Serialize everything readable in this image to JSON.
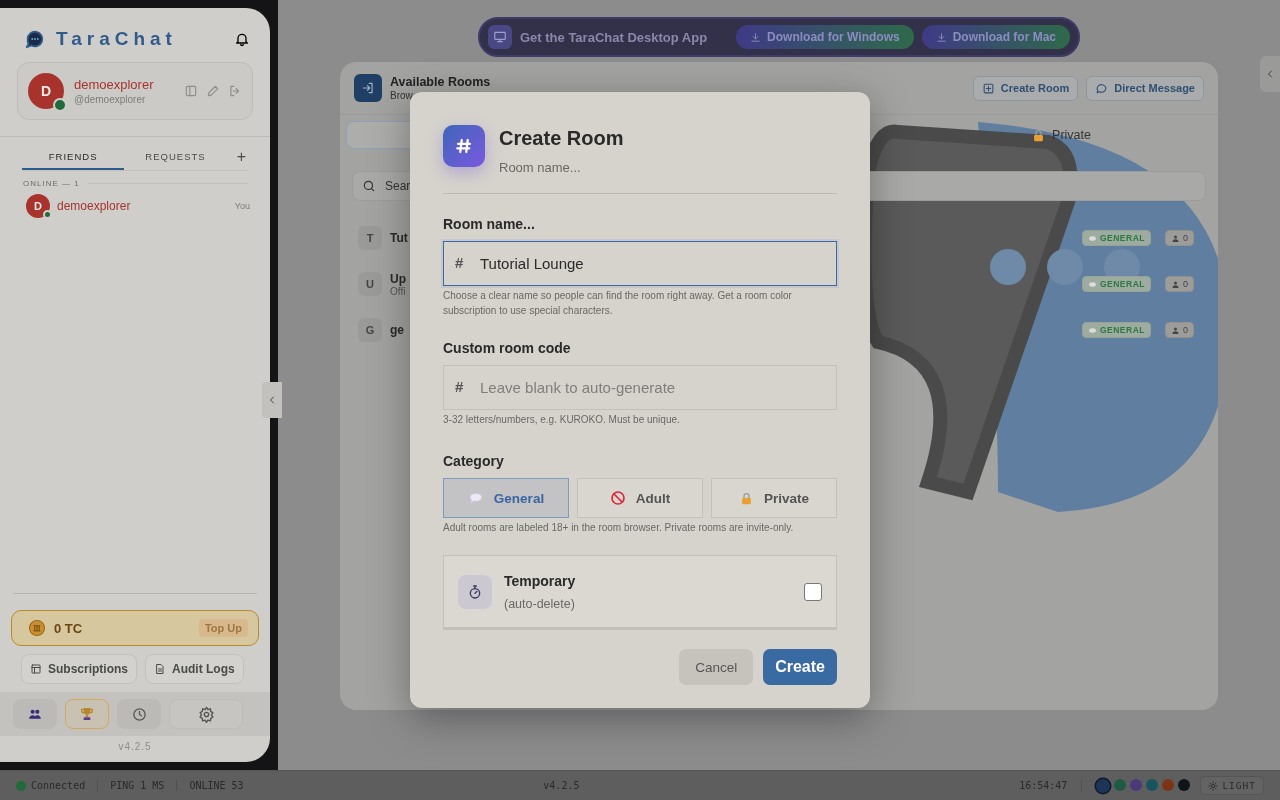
{
  "sidebar": {
    "brand": "TaraChat",
    "profile": {
      "avatar": "D",
      "name": "demoexplorer",
      "handle": "@demoexplorer",
      "online": true
    },
    "tabs": [
      {
        "label": "FRIENDS",
        "selected": true
      },
      {
        "label": "REQUESTS",
        "selected": false
      }
    ],
    "add_button": "+",
    "section_label": "ONLINE — 1",
    "friends": [
      {
        "avatar": "D",
        "name": "demoexplorer",
        "note": "You",
        "online": true
      }
    ],
    "balance": {
      "amount": "0 TC",
      "action": "Top Up"
    },
    "links": [
      {
        "label": "Subscriptions",
        "kind": "subscriptions"
      },
      {
        "label": "Audit Logs",
        "kind": "logs"
      }
    ],
    "nav": [
      {
        "kind": "friends",
        "selected": false
      },
      {
        "kind": "trophy",
        "selected": true
      },
      {
        "kind": "history",
        "selected": false
      },
      {
        "kind": "settings",
        "selected": false
      }
    ],
    "version": "v4.2.5"
  },
  "banner": {
    "text": "Get the TaraChat Desktop App",
    "buttons": [
      "Download for Windows",
      "Download for Mac"
    ]
  },
  "rooms_panel": {
    "title": "Available Rooms",
    "subtitle": "Brow",
    "actions": [
      {
        "label": "Create Room",
        "kind": "create"
      },
      {
        "label": "Direct Message",
        "kind": "message"
      }
    ],
    "tabs": [
      {
        "selected": true
      },
      {
        "label": "Private",
        "selected": false
      }
    ],
    "search": {
      "placeholder": "Sear"
    },
    "rooms": [
      {
        "initial": "T",
        "name": "Tut",
        "category": "GENERAL",
        "members": "0"
      },
      {
        "initial": "U",
        "name": "Up",
        "detail": "Offi",
        "category": "GENERAL",
        "members": "0"
      },
      {
        "initial": "G",
        "name": "ge",
        "category": "GENERAL",
        "members": "0"
      }
    ]
  },
  "dialog": {
    "title": "Create Room",
    "subtitle": "Room name...",
    "fields": [
      {
        "label": "Room name...",
        "prefix": "#",
        "value": "Tutorial Lounge",
        "focused": true,
        "hint": "Choose a clear name so people can find the room right away. Get a room color subscription to use special characters."
      },
      {
        "label": "Custom room code",
        "prefix": "#",
        "placeholder": "Leave blank to auto-generate",
        "focused": false,
        "hint": "3-32 letters/numbers, e.g. KUROKO. Must be unique."
      }
    ],
    "category": {
      "label": "Category",
      "options": [
        {
          "label": "General",
          "kind": "general",
          "selected": true
        },
        {
          "label": "Adult",
          "kind": "adult",
          "selected": false
        },
        {
          "label": "Private",
          "kind": "private",
          "selected": false
        }
      ],
      "hint": "Adult rooms are labeled 18+ in the room browser. Private rooms are invite-only."
    },
    "temporary": {
      "title": "Temporary",
      "subtitle": "(auto-delete)",
      "checked": false
    },
    "buttons": [
      {
        "label": "Cancel",
        "kind": "secondary"
      },
      {
        "label": "Create",
        "kind": "primary"
      }
    ]
  },
  "status_bar": {
    "connection": {
      "label": "Connected",
      "online": true
    },
    "ping": "PING 1 MS",
    "online": "ONLINE 53",
    "version": "v4.2.5",
    "time": "16:54:47",
    "themes": [
      {
        "color": "#1d3557",
        "selected": true
      },
      {
        "color": "#1f5a45",
        "selected": false
      },
      {
        "color": "#4a3a7a",
        "selected": false
      },
      {
        "color": "#17545e",
        "selected": false
      },
      {
        "color": "#7a3516",
        "selected": false
      },
      {
        "color": "#111418",
        "selected": false
      }
    ],
    "mode": "LIGHT"
  }
}
